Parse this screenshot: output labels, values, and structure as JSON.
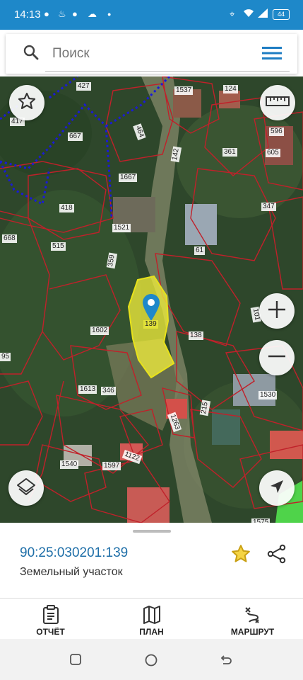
{
  "status_bar": {
    "time": "14:13",
    "battery": "44",
    "icons": [
      "chat-icon",
      "flame-icon",
      "chat-bubbles-icon",
      "cloud-icon",
      "dot-icon",
      "location-icon",
      "wifi-icon",
      "signal-icon",
      "battery-icon"
    ]
  },
  "search": {
    "placeholder": "Поиск"
  },
  "map": {
    "selected_parcel_label": "139",
    "parcel_labels": [
      "427",
      "124",
      "1537",
      "417",
      "667",
      "1667",
      "142",
      "596",
      "605",
      "361",
      "464",
      "418",
      "347",
      "668",
      "1521",
      "515",
      "61",
      "359",
      "1602",
      "101",
      "138",
      "1613",
      "346",
      "1530",
      "215",
      "1263",
      "1540",
      "1597",
      "1122",
      "95",
      "1575"
    ],
    "colors": {
      "parcel_border": "#c0212a",
      "selected_fill": "#f5f23c",
      "pin": "#1e88c9",
      "boundary": "#1a1ad8"
    }
  },
  "details": {
    "cadastral_number": "90:25:030201:139",
    "object_type": "Земельный участок",
    "accent_color": "#1f6fa8",
    "star_color": "#d4a017"
  },
  "tabs": [
    {
      "label": "ОТЧЁТ",
      "icon": "report-icon"
    },
    {
      "label": "ПЛАН",
      "icon": "map-plan-icon"
    },
    {
      "label": "МАРШРУТ",
      "icon": "route-icon"
    }
  ],
  "nav": {
    "icons": [
      "recent-apps-icon",
      "home-icon",
      "back-icon"
    ]
  }
}
